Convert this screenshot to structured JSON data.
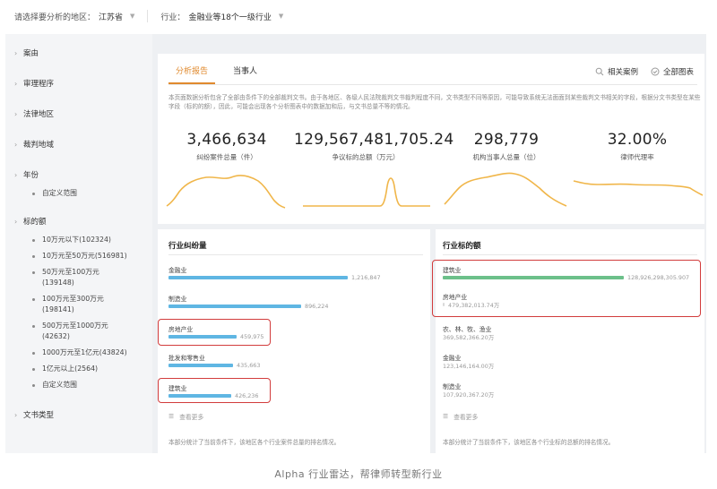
{
  "topbar": {
    "region_label": "请选择要分析的地区：",
    "region_value": "江苏省",
    "industry_label": "行业：",
    "industry_value": "金融业等18个一级行业"
  },
  "sidebar": {
    "sections": [
      {
        "label": "案由"
      },
      {
        "label": "审理程序"
      },
      {
        "label": "法律地区"
      },
      {
        "label": "裁判地域"
      },
      {
        "label": "年份"
      },
      {
        "label": "标的额"
      },
      {
        "label": "文书类型"
      }
    ],
    "year_items": [
      "自定义范围"
    ],
    "amount_items": [
      "10万元以下(102324)",
      "10万元至50万元(516981)",
      "50万元至100万元(139148)",
      "100万元至300万元(198141)",
      "500万元至1000万元(42632)",
      "1000万元至1亿元(43824)",
      "1亿元以上(2564)",
      "自定义范围"
    ]
  },
  "tabs": [
    "分析报告",
    "当事人"
  ],
  "actions": {
    "related": "相关案例",
    "all_charts": "全部图表"
  },
  "description": "本页面数据分析包含了全部由条件下的全部裁判文书。由于各地区、各级人民法院裁判文书裁判程度不同，文书类型不同等原因，可能导致系统无法面面到某些裁判文书相关的字段，根据分文书类型在某些字段（标的的额），因此，可能会出现各个分析图表中的数据加和后，与文书总量不等的情况。",
  "stats": [
    {
      "value": "3,466,634",
      "label": "纠纷案件总量（件）"
    },
    {
      "value": "129,567,481,705.24",
      "label": "争议标的总额（万元）"
    },
    {
      "value": "298,779",
      "label": "机构当事人总量（位）"
    },
    {
      "value": "32.00%",
      "label": "律师代理率"
    }
  ],
  "disputes": {
    "title": "行业纠纷量",
    "items": [
      {
        "name": "金融业",
        "value": "1,216,847"
      },
      {
        "name": "制造业",
        "value": "896,224"
      },
      {
        "name": "房地产业",
        "value": "459,975"
      },
      {
        "name": "批发和零售业",
        "value": "435,663"
      },
      {
        "name": "建筑业",
        "value": "426,236"
      }
    ],
    "more": "查看更多",
    "footer": "本部分统计了当前条件下，该地区各个行业案件总量的排名情况。"
  },
  "amounts": {
    "title": "行业标的额",
    "items": [
      {
        "name": "建筑业",
        "value": "128,926,298,305.907"
      },
      {
        "name": "房地产业",
        "value": "479,382,013.74万"
      },
      {
        "name": "农、林、牧、渔业",
        "value": "369,582,366.20万"
      },
      {
        "name": "金融业",
        "value": "123,146,164.00万"
      },
      {
        "name": "制造业",
        "value": "107,920,367.20万"
      }
    ],
    "more": "查看更多",
    "footer": "本部分统计了当前条件下，该地区各个行业标的总额的排名情况。"
  },
  "caption": "Alpha 行业雷达，帮律师转型新行业",
  "colors": {
    "accent": "#e08a2e",
    "bar_blue": "#5fb6e3",
    "bar_green": "#6cc08a",
    "highlight": "#d23c3c",
    "sparkline": "#f0b64a"
  }
}
